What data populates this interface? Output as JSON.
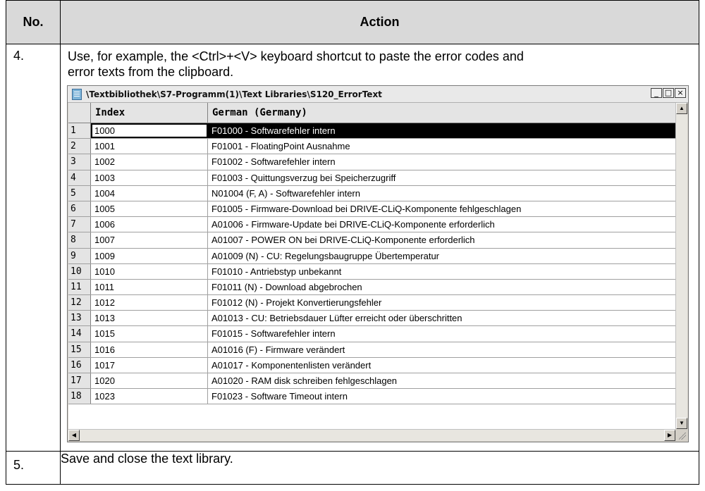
{
  "table": {
    "header_no": "No.",
    "header_action": "Action",
    "step4_no": "4.",
    "step4_text_line1": "Use, for example, the <Ctrl>+<V> keyboard shortcut to paste the error codes and",
    "step4_text_line2": "error texts from the clipboard.",
    "step5_no": "5.",
    "step5_text": "Save and close the text library."
  },
  "window": {
    "title": "\\Textbibliothek\\S7-Programm(1)\\Text Libraries\\S120_ErrorText",
    "minimize": "_",
    "maximize": "□",
    "close": "×",
    "columns": [
      "",
      "Index",
      "German (Germany)"
    ],
    "selected_row": 1,
    "rows": [
      {
        "n": "1",
        "index": "1000",
        "text": "F01000 - Softwarefehler intern"
      },
      {
        "n": "2",
        "index": "1001",
        "text": "F01001 - FloatingPoint Ausnahme"
      },
      {
        "n": "3",
        "index": "1002",
        "text": "F01002 - Softwarefehler intern"
      },
      {
        "n": "4",
        "index": "1003",
        "text": "F01003 - Quittungsverzug bei Speicherzugriff"
      },
      {
        "n": "5",
        "index": "1004",
        "text": "N01004 (F, A) - Softwarefehler intern"
      },
      {
        "n": "6",
        "index": "1005",
        "text": "F01005 - Firmware-Download bei DRIVE-CLiQ-Komponente fehlgeschlagen"
      },
      {
        "n": "7",
        "index": "1006",
        "text": "A01006 - Firmware-Update bei DRIVE-CLiQ-Komponente erforderlich"
      },
      {
        "n": "8",
        "index": "1007",
        "text": "A01007 - POWER ON bei DRIVE-CLiQ-Komponente erforderlich"
      },
      {
        "n": "9",
        "index": "1009",
        "text": "A01009 (N) - CU: Regelungsbaugruppe Übertemperatur"
      },
      {
        "n": "10",
        "index": "1010",
        "text": "F01010 - Antriebstyp unbekannt"
      },
      {
        "n": "11",
        "index": "1011",
        "text": "F01011 (N) - Download abgebrochen"
      },
      {
        "n": "12",
        "index": "1012",
        "text": "F01012 (N) - Projekt Konvertierungsfehler"
      },
      {
        "n": "13",
        "index": "1013",
        "text": "A01013 - CU: Betriebsdauer Lüfter erreicht oder überschritten"
      },
      {
        "n": "14",
        "index": "1015",
        "text": "F01015 - Softwarefehler intern"
      },
      {
        "n": "15",
        "index": "1016",
        "text": "A01016 (F) - Firmware verändert"
      },
      {
        "n": "16",
        "index": "1017",
        "text": "A01017 - Komponentenlisten verändert"
      },
      {
        "n": "17",
        "index": "1020",
        "text": "A01020 - RAM disk schreiben fehlgeschlagen"
      },
      {
        "n": "18",
        "index": "1023",
        "text": "F01023 - Software Timeout intern"
      }
    ]
  }
}
